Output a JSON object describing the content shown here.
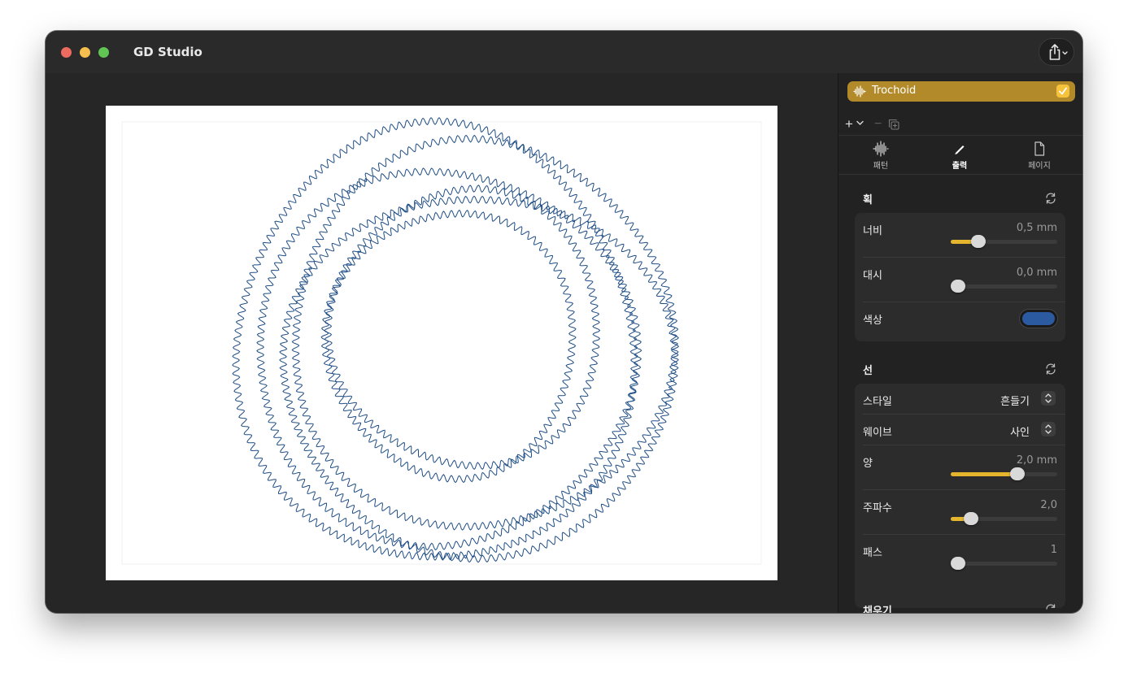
{
  "app": {
    "title": "GD Studio"
  },
  "toolbar": {
    "share_icon": "share-icon"
  },
  "canvas": {
    "stroke_color": "#1f4e86",
    "paper_color": "#ffffff"
  },
  "layer": {
    "name": "Trochoid",
    "enabled": true,
    "accent": "#b38a2a"
  },
  "layer_tools": {
    "add": "+",
    "remove": "−"
  },
  "tabs": [
    {
      "label": "패턴",
      "icon": "waveform-icon",
      "active": false
    },
    {
      "label": "출력",
      "icon": "pen-icon",
      "active": true
    },
    {
      "label": "페이지",
      "icon": "page-icon",
      "active": false
    }
  ],
  "stroke": {
    "title": "획",
    "width": {
      "label": "너비",
      "value": "0,5 mm",
      "level": 0.22
    },
    "dash": {
      "label": "대시",
      "value": "0,0 mm",
      "level": 0.0
    },
    "color": {
      "label": "색상",
      "value": "#2c5aa0"
    }
  },
  "line": {
    "title": "선",
    "style": {
      "label": "스타일",
      "value": "흔들기"
    },
    "wave": {
      "label": "웨이브",
      "value": "사인"
    },
    "amount": {
      "label": "양",
      "value": "2,0 mm",
      "level": 0.65
    },
    "frequency": {
      "label": "주파수",
      "value": "2,0",
      "level": 0.14
    },
    "passes": {
      "label": "패스",
      "value": "1",
      "level": 0.0
    }
  },
  "fill": {
    "title": "채우기"
  }
}
